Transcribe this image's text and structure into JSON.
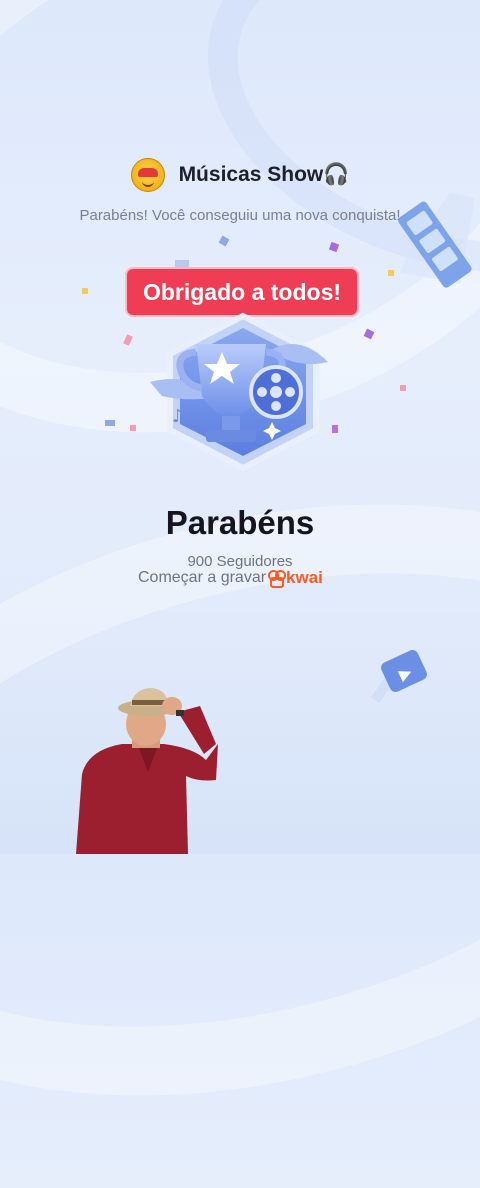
{
  "header": {
    "app_title": "Músicas Show🎧",
    "avatar_icon": "smiley-face-avatar"
  },
  "subtitle": "Parabéns! Você conseguiu uma nova conquista!",
  "banner": {
    "text": "Obrigado a todos!",
    "color": "#ef3d55"
  },
  "achievement": {
    "title": "Parabéns",
    "followers": "900 Seguidores",
    "cta": "Começar a gravar",
    "brand": "kwai",
    "brand_color": "#ff5a1f"
  },
  "icons": {
    "badge": "trophy-film-badge-icon",
    "film_strip": "film-strip-icon",
    "play": "play-tile-icon",
    "person": "man-in-hat-sticker"
  }
}
